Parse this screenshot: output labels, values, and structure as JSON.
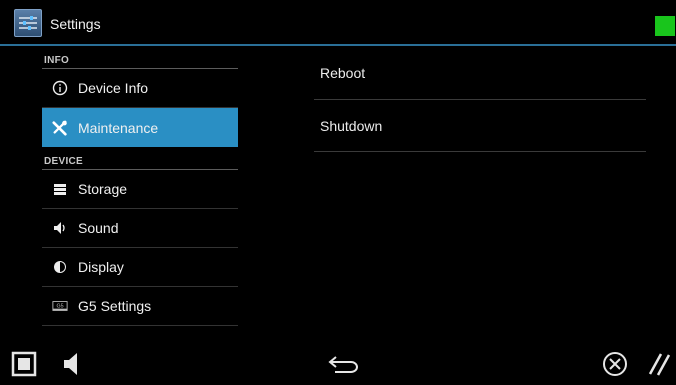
{
  "app": {
    "title": "Settings",
    "icon": "settings-sliders-icon",
    "status_color": "#19c51c"
  },
  "sidebar": {
    "sections": [
      {
        "header": "INFO",
        "items": [
          {
            "label": "Device Info",
            "icon": "info-icon",
            "selected": false
          },
          {
            "label": "Maintenance",
            "icon": "wrench-icon",
            "selected": true
          }
        ]
      },
      {
        "header": "DEVICE",
        "items": [
          {
            "label": "Storage",
            "icon": "storage-icon",
            "selected": false
          },
          {
            "label": "Sound",
            "icon": "speaker-icon",
            "selected": false
          },
          {
            "label": "Display",
            "icon": "brightness-icon",
            "selected": false
          },
          {
            "label": "G5 Settings",
            "icon": "g5-icon",
            "selected": false
          }
        ]
      }
    ],
    "selected_color": "#2a8fc4"
  },
  "main": {
    "items": [
      {
        "label": "Reboot"
      },
      {
        "label": "Shutdown"
      }
    ]
  },
  "navbar": {
    "buttons": [
      "home-square-icon",
      "volume-icon",
      "back-icon",
      "close-icon",
      "resize-grip-icon"
    ]
  }
}
